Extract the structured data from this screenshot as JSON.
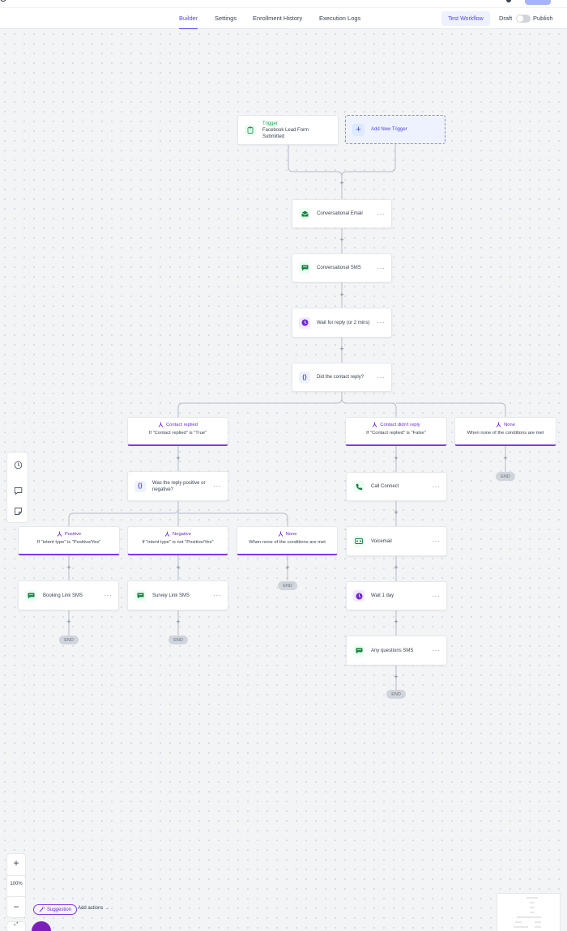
{
  "header": {
    "tabs": [
      {
        "label": "Builder",
        "active": true
      },
      {
        "label": "Settings",
        "active": false
      },
      {
        "label": "Enrollment History",
        "active": false
      },
      {
        "label": "Execution Logs",
        "active": false
      }
    ],
    "test_workflow": "Test Workflow",
    "draft": "Draft",
    "publish": "Publish",
    "publish_enabled": false
  },
  "trigger": {
    "title": "Trigger",
    "subtitle": "Facebook Lead Form Submitted",
    "icon": "clipboard-icon"
  },
  "add_trigger": "Add New Trigger",
  "actions": {
    "email": {
      "label": "Conversational Email",
      "icon": "email-icon"
    },
    "sms": {
      "label": "Conversational SMS",
      "icon": "sms-icon"
    },
    "wait_reply": {
      "label": "Wait for reply (or 2 mins)",
      "icon": "clock-icon"
    },
    "condition": {
      "label": "Did the contact reply?",
      "icon": "braces-icon"
    },
    "condition2": {
      "label": "Was the reply positive or negative?",
      "icon": "braces-icon"
    },
    "call": {
      "label": "Call Connect",
      "icon": "phone-icon"
    },
    "voicemail": {
      "label": "Voicemail",
      "icon": "voicemail-icon"
    },
    "wait_day": {
      "label": "Wait 1 day",
      "icon": "clock-icon"
    },
    "questions_sms": {
      "label": "Any questions SMS",
      "icon": "sms-icon"
    },
    "booking_sms": {
      "label": "Booking Link SMS",
      "icon": "sms-icon"
    },
    "survey_sms": {
      "label": "Survey Link SMS",
      "icon": "sms-icon"
    }
  },
  "branches": {
    "replied": {
      "title": "Contact replied",
      "subtitle": "If \"Contact replied\" is \"True\""
    },
    "not_replied": {
      "title": "Contact didn't reply",
      "subtitle": "If \"Contact replied\" is \"False\""
    },
    "none_top": {
      "title": "None",
      "subtitle": "When none of the conditions are met"
    },
    "positive": {
      "title": "Positive",
      "subtitle": "If \"intent type\" is \"Positive/Yes\""
    },
    "negative": {
      "title": "Negative",
      "subtitle": "If \"intent type\" is not \"Positive/Yes\""
    },
    "none_inner": {
      "title": "None",
      "subtitle": "When none of the conditions are met"
    }
  },
  "end_label": "END",
  "plus_label": "+",
  "dots_label": "···",
  "zoom": {
    "plus": "+",
    "level": "100%",
    "minus": "−"
  },
  "suggestion": "Suggestion",
  "add_actions": "Add actions",
  "colors": {
    "accent": "#4f46e5",
    "branch": "#7c3aed",
    "green": "#16a34a"
  }
}
